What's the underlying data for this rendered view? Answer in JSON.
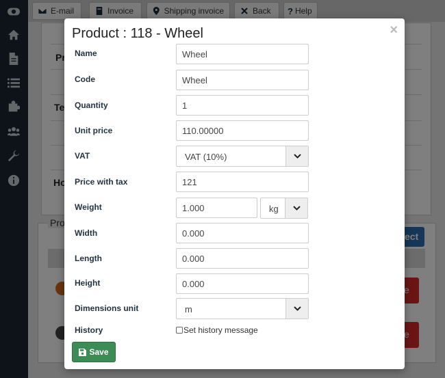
{
  "toolbar": {
    "email_label": "E-mail",
    "invoice_label": "Invoice",
    "shipping_label": "Shipping invoice",
    "back_label": "Back",
    "help_label": "Help"
  },
  "sidebar": {
    "icons": [
      "toggle-icon",
      "home-icon",
      "document-icon",
      "list-icon",
      "puzzle-icon",
      "users-icon",
      "wrench-icon",
      "info-icon"
    ]
  },
  "background": {
    "labels": [
      "Pr",
      "Te",
      "Ho"
    ],
    "section_legend": "Pro",
    "select_button_fragment": "ect",
    "red_button_fragment": "e"
  },
  "modal": {
    "title": "Product : 118 - Wheel",
    "close_symbol": "×",
    "fields": {
      "name": {
        "label": "Name",
        "value": "Wheel"
      },
      "code": {
        "label": "Code",
        "value": "Wheel"
      },
      "quantity": {
        "label": "Quantity",
        "value": "1"
      },
      "unit_price": {
        "label": "Unit price",
        "value": "110.00000"
      },
      "vat": {
        "label": "VAT",
        "value": "VAT (10%)"
      },
      "price_with_tax": {
        "label": "Price with tax",
        "value": "121"
      },
      "weight": {
        "label": "Weight",
        "value": "1.000",
        "unit": "kg"
      },
      "width": {
        "label": "Width",
        "value": "0.000"
      },
      "length": {
        "label": "Length",
        "value": "0.000"
      },
      "height": {
        "label": "Height",
        "value": "0.000"
      },
      "dimensions_unit": {
        "label": "Dimensions unit",
        "value": "m"
      },
      "history": {
        "label": "History",
        "checkbox_label": "Set history message"
      }
    },
    "save_label": "Save"
  },
  "colors": {
    "sidebar": "#1b2733",
    "save_button": "#3d8b55",
    "select_button": "#2b6cb0",
    "delete_button": "#d62b2b"
  }
}
